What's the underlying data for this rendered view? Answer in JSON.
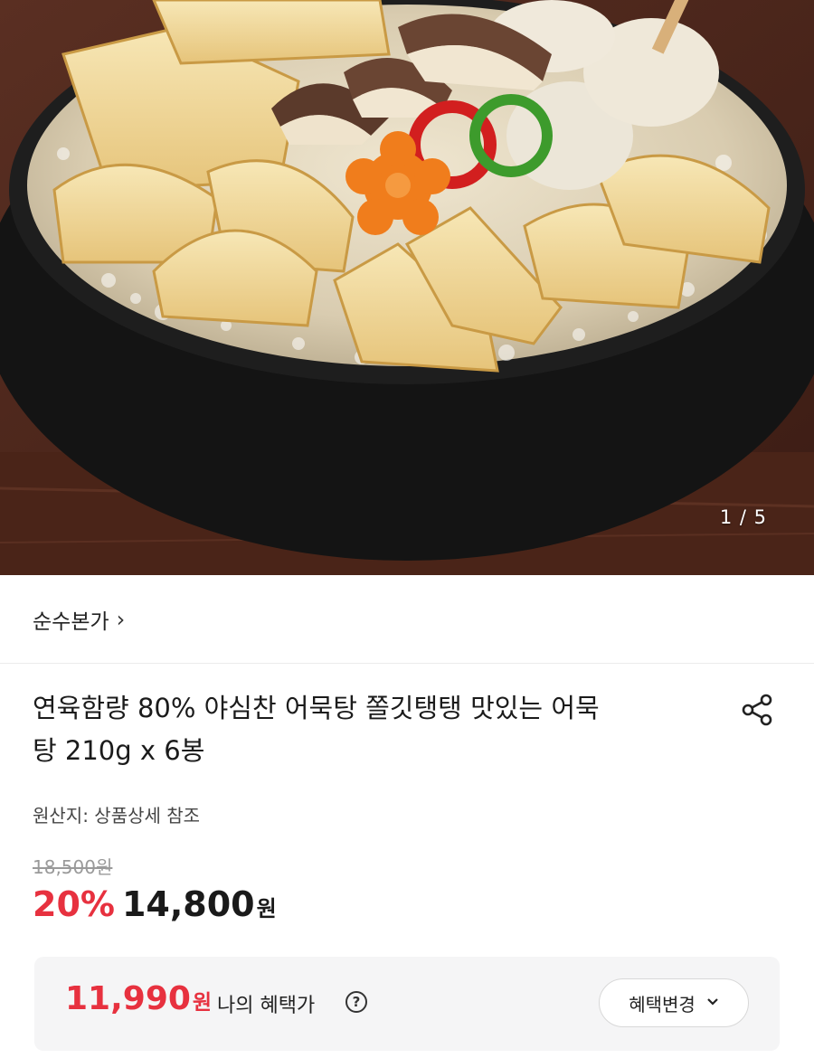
{
  "carousel": {
    "current": "1",
    "total": "5",
    "counter_text": "1 / 5"
  },
  "seller": {
    "name": "순수본가",
    "chevron": "›"
  },
  "product": {
    "title_line1": "연육함량 80% 야심찬 어묵탕 쫄깃탱탱 맛있는 어묵",
    "title_line2": "탕 210g x 6봉",
    "origin": "원산지: 상품상세 참조",
    "original_price": "18,500원",
    "discount_rate": "20%",
    "sale_price": "14,800",
    "sale_price_unit": "원"
  },
  "benefit": {
    "amount": "11,990",
    "unit": "원",
    "label": "나의 혜택가",
    "help_glyph": "?",
    "change_button_label": "혜택변경",
    "change_button_chevron": "⌄"
  },
  "icons": {
    "share": "share-icon",
    "help": "question-circle-icon",
    "chevron": "chevron-right-icon",
    "dropdown": "chevron-down-icon"
  },
  "colors": {
    "accent_red": "#e7313f",
    "text_primary": "#1a1a1a",
    "text_muted": "#9a9a9a",
    "benefit_bg": "#f5f5f6"
  }
}
